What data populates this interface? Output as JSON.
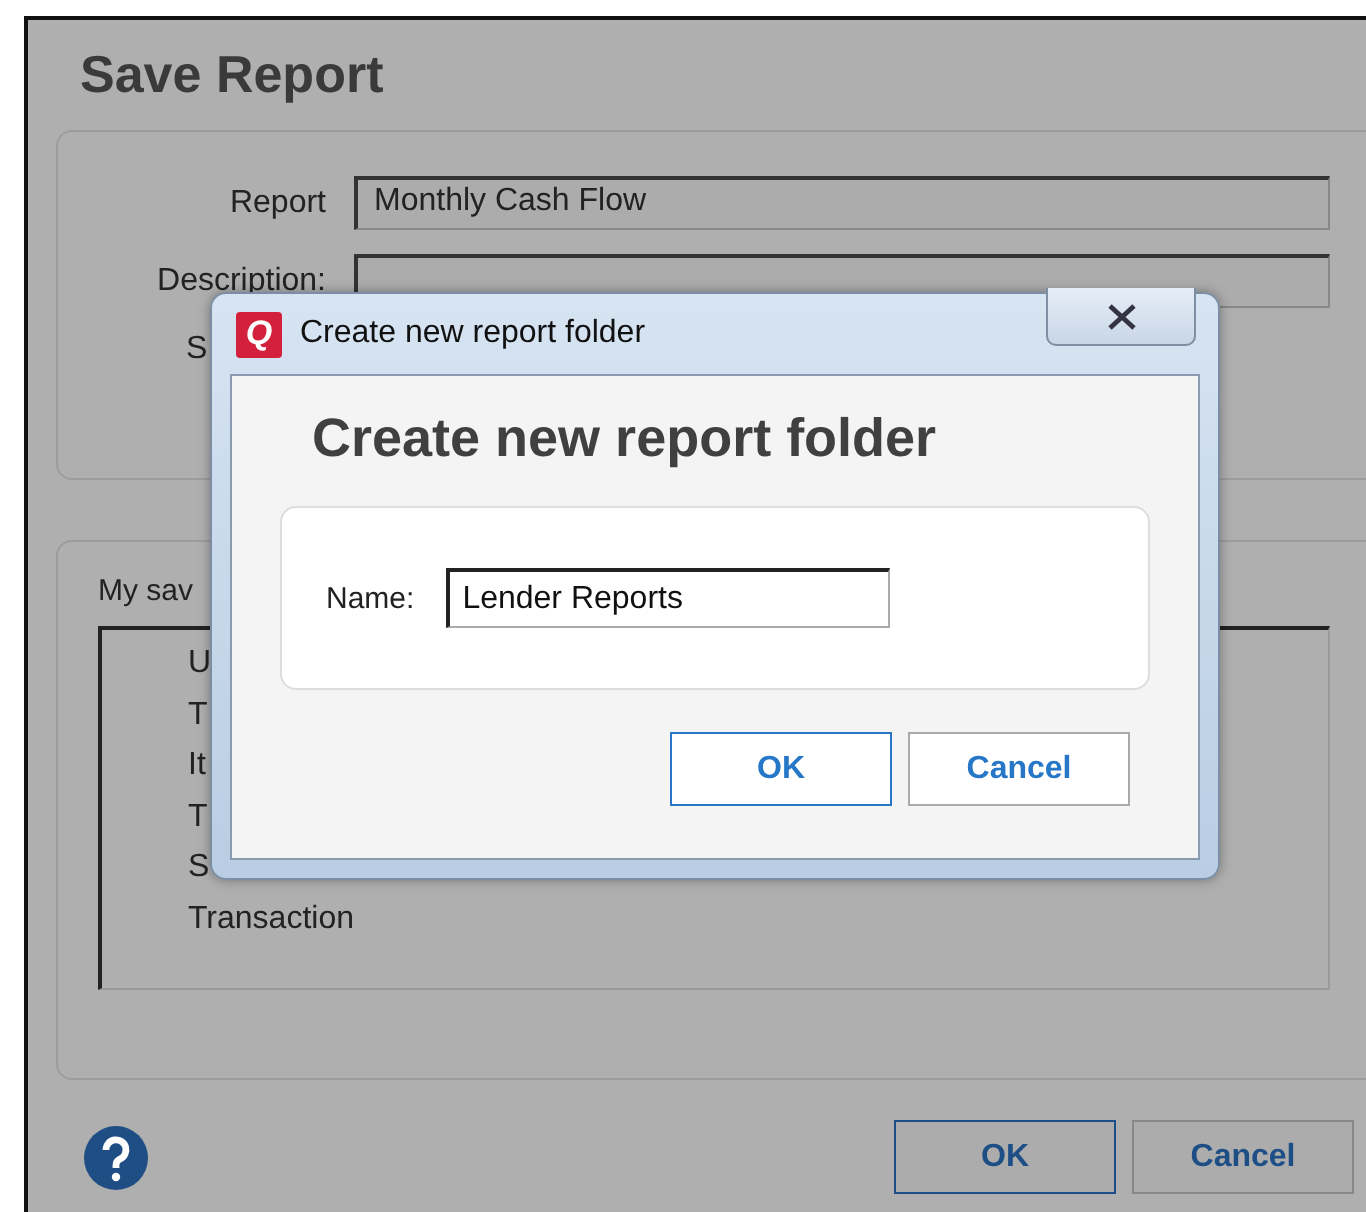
{
  "window": {
    "title": "Save Report"
  },
  "details": {
    "fields": [
      {
        "label": "Report",
        "value": "Monthly Cash Flow"
      },
      {
        "label": "Description:"
      }
    ],
    "cut_label": "S"
  },
  "saved_reports": {
    "label": "My sav",
    "items": [
      "U",
      "T",
      "It",
      "T",
      "S",
      "Transaction"
    ]
  },
  "buttons": [
    {
      "label": "OK",
      "default": true
    },
    {
      "label": "Cancel",
      "default": false
    }
  ],
  "modal": {
    "app_icon_letter": "Q",
    "title": "Create new report folder",
    "heading": "Create new report folder",
    "name_label": "Name:",
    "name_value": "Lender Reports",
    "buttons": [
      {
        "label": "OK",
        "default": true
      },
      {
        "label": "Cancel",
        "default": false
      }
    ]
  }
}
